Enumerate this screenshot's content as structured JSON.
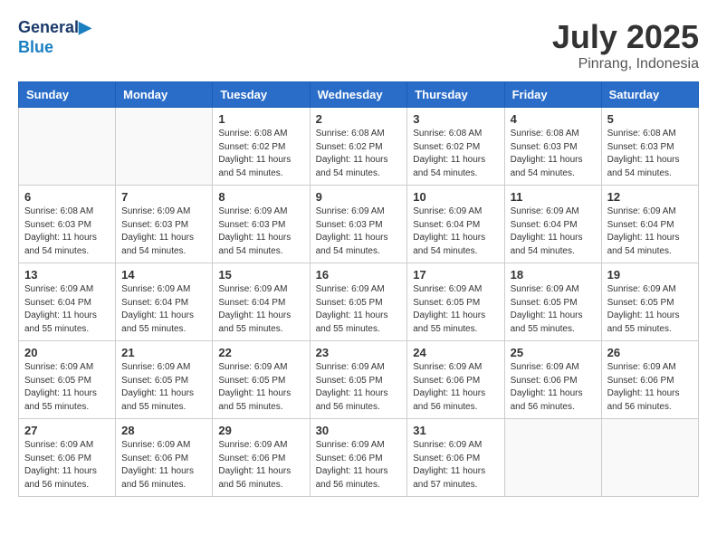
{
  "header": {
    "logo_line1": "General",
    "logo_line2": "Blue",
    "month": "July 2025",
    "location": "Pinrang, Indonesia"
  },
  "weekdays": [
    "Sunday",
    "Monday",
    "Tuesday",
    "Wednesday",
    "Thursday",
    "Friday",
    "Saturday"
  ],
  "weeks": [
    [
      {
        "day": "",
        "info": ""
      },
      {
        "day": "",
        "info": ""
      },
      {
        "day": "1",
        "info": "Sunrise: 6:08 AM\nSunset: 6:02 PM\nDaylight: 11 hours and 54 minutes."
      },
      {
        "day": "2",
        "info": "Sunrise: 6:08 AM\nSunset: 6:02 PM\nDaylight: 11 hours and 54 minutes."
      },
      {
        "day": "3",
        "info": "Sunrise: 6:08 AM\nSunset: 6:02 PM\nDaylight: 11 hours and 54 minutes."
      },
      {
        "day": "4",
        "info": "Sunrise: 6:08 AM\nSunset: 6:03 PM\nDaylight: 11 hours and 54 minutes."
      },
      {
        "day": "5",
        "info": "Sunrise: 6:08 AM\nSunset: 6:03 PM\nDaylight: 11 hours and 54 minutes."
      }
    ],
    [
      {
        "day": "6",
        "info": "Sunrise: 6:08 AM\nSunset: 6:03 PM\nDaylight: 11 hours and 54 minutes."
      },
      {
        "day": "7",
        "info": "Sunrise: 6:09 AM\nSunset: 6:03 PM\nDaylight: 11 hours and 54 minutes."
      },
      {
        "day": "8",
        "info": "Sunrise: 6:09 AM\nSunset: 6:03 PM\nDaylight: 11 hours and 54 minutes."
      },
      {
        "day": "9",
        "info": "Sunrise: 6:09 AM\nSunset: 6:03 PM\nDaylight: 11 hours and 54 minutes."
      },
      {
        "day": "10",
        "info": "Sunrise: 6:09 AM\nSunset: 6:04 PM\nDaylight: 11 hours and 54 minutes."
      },
      {
        "day": "11",
        "info": "Sunrise: 6:09 AM\nSunset: 6:04 PM\nDaylight: 11 hours and 54 minutes."
      },
      {
        "day": "12",
        "info": "Sunrise: 6:09 AM\nSunset: 6:04 PM\nDaylight: 11 hours and 54 minutes."
      }
    ],
    [
      {
        "day": "13",
        "info": "Sunrise: 6:09 AM\nSunset: 6:04 PM\nDaylight: 11 hours and 55 minutes."
      },
      {
        "day": "14",
        "info": "Sunrise: 6:09 AM\nSunset: 6:04 PM\nDaylight: 11 hours and 55 minutes."
      },
      {
        "day": "15",
        "info": "Sunrise: 6:09 AM\nSunset: 6:04 PM\nDaylight: 11 hours and 55 minutes."
      },
      {
        "day": "16",
        "info": "Sunrise: 6:09 AM\nSunset: 6:05 PM\nDaylight: 11 hours and 55 minutes."
      },
      {
        "day": "17",
        "info": "Sunrise: 6:09 AM\nSunset: 6:05 PM\nDaylight: 11 hours and 55 minutes."
      },
      {
        "day": "18",
        "info": "Sunrise: 6:09 AM\nSunset: 6:05 PM\nDaylight: 11 hours and 55 minutes."
      },
      {
        "day": "19",
        "info": "Sunrise: 6:09 AM\nSunset: 6:05 PM\nDaylight: 11 hours and 55 minutes."
      }
    ],
    [
      {
        "day": "20",
        "info": "Sunrise: 6:09 AM\nSunset: 6:05 PM\nDaylight: 11 hours and 55 minutes."
      },
      {
        "day": "21",
        "info": "Sunrise: 6:09 AM\nSunset: 6:05 PM\nDaylight: 11 hours and 55 minutes."
      },
      {
        "day": "22",
        "info": "Sunrise: 6:09 AM\nSunset: 6:05 PM\nDaylight: 11 hours and 55 minutes."
      },
      {
        "day": "23",
        "info": "Sunrise: 6:09 AM\nSunset: 6:05 PM\nDaylight: 11 hours and 56 minutes."
      },
      {
        "day": "24",
        "info": "Sunrise: 6:09 AM\nSunset: 6:06 PM\nDaylight: 11 hours and 56 minutes."
      },
      {
        "day": "25",
        "info": "Sunrise: 6:09 AM\nSunset: 6:06 PM\nDaylight: 11 hours and 56 minutes."
      },
      {
        "day": "26",
        "info": "Sunrise: 6:09 AM\nSunset: 6:06 PM\nDaylight: 11 hours and 56 minutes."
      }
    ],
    [
      {
        "day": "27",
        "info": "Sunrise: 6:09 AM\nSunset: 6:06 PM\nDaylight: 11 hours and 56 minutes."
      },
      {
        "day": "28",
        "info": "Sunrise: 6:09 AM\nSunset: 6:06 PM\nDaylight: 11 hours and 56 minutes."
      },
      {
        "day": "29",
        "info": "Sunrise: 6:09 AM\nSunset: 6:06 PM\nDaylight: 11 hours and 56 minutes."
      },
      {
        "day": "30",
        "info": "Sunrise: 6:09 AM\nSunset: 6:06 PM\nDaylight: 11 hours and 56 minutes."
      },
      {
        "day": "31",
        "info": "Sunrise: 6:09 AM\nSunset: 6:06 PM\nDaylight: 11 hours and 57 minutes."
      },
      {
        "day": "",
        "info": ""
      },
      {
        "day": "",
        "info": ""
      }
    ]
  ]
}
